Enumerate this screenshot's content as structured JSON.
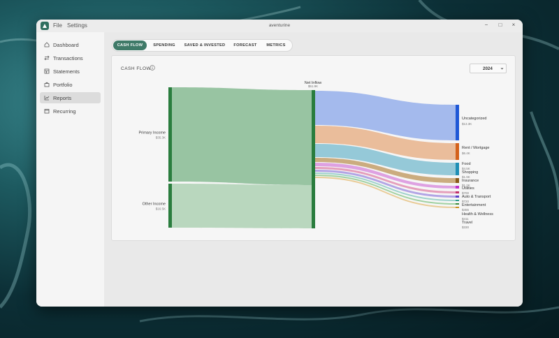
{
  "window": {
    "title": "aventurine",
    "menu": [
      "File",
      "Settings"
    ],
    "controls": {
      "minimize": "−",
      "maximize": "□",
      "close": "×"
    }
  },
  "sidebar": {
    "items": [
      {
        "label": "Dashboard",
        "icon": "home-icon",
        "active": false
      },
      {
        "label": "Transactions",
        "icon": "transfer-icon",
        "active": false
      },
      {
        "label": "Statements",
        "icon": "document-icon",
        "active": false
      },
      {
        "label": "Portfolio",
        "icon": "portfolio-icon",
        "active": false
      },
      {
        "label": "Reports",
        "icon": "chart-icon",
        "active": true
      },
      {
        "label": "Recurring",
        "icon": "recurring-icon",
        "active": false
      }
    ]
  },
  "tabs": [
    {
      "label": "CASH FLOW",
      "active": true
    },
    {
      "label": "SPENDING",
      "active": false
    },
    {
      "label": "SAVED & INVESTED",
      "active": false
    },
    {
      "label": "FORECAST",
      "active": false
    },
    {
      "label": "METRICS",
      "active": false
    }
  ],
  "report": {
    "title": "CASH FLOW",
    "year": "2024"
  },
  "colors": {
    "accent": "#3f7a68",
    "income": "#2a7d3e"
  },
  "chart_data": {
    "type": "sankey",
    "nodes": {
      "sources": [
        {
          "name": "Primary Income",
          "value_label": "$35.3K",
          "color": "#2a7d3e"
        },
        {
          "name": "Other Income",
          "value_label": "$16.5K",
          "color": "#2a7d3e"
        }
      ],
      "hub": {
        "name": "Net Inflow",
        "value_label": "$51.9K",
        "color": "#2a7d3e"
      },
      "targets": [
        {
          "name": "Uncategorized",
          "value_label": "$13.3K",
          "color": "#1f58d6",
          "flow": "#9fb6ec"
        },
        {
          "name": "Rent / Mortgage",
          "value_label": "$6.4K",
          "color": "#d4621c",
          "flow": "#e9b996"
        },
        {
          "name": "Food",
          "value_label": "$4.5K",
          "color": "#1f8fb5",
          "flow": "#8fc6d6"
        },
        {
          "name": "Shopping",
          "value_label": "$1.9K",
          "color": "#8a5a18",
          "flow": "#c8a878"
        },
        {
          "name": "Insurance",
          "value_label": "$1.2K",
          "color": "#c030c8",
          "flow": "#dc9ce0"
        },
        {
          "name": "Utilities",
          "value_label": "$700",
          "color": "#c0306a",
          "flow": "#e49ab8"
        },
        {
          "name": "Auto & Transport",
          "value_label": "$720",
          "color": "#5a40c8",
          "flow": "#aea0e4"
        },
        {
          "name": "Entertainment",
          "value_label": "$455",
          "color": "#2a9a8a",
          "flow": "#98d0c8"
        },
        {
          "name": "Health & Wellness",
          "value_label": "$411",
          "color": "#3a8a3a",
          "flow": "#9ccf9c"
        },
        {
          "name": "Travel",
          "value_label": "$330",
          "color": "#c8901c",
          "flow": "#e8c890"
        }
      ]
    }
  }
}
